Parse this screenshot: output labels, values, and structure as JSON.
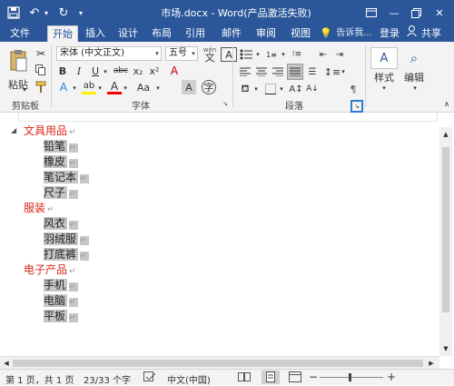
{
  "window": {
    "title": "市场.docx - Word(产品激活失败)",
    "restore_icon": "restore-icon",
    "min": "—",
    "close": "✕"
  },
  "tabs": [
    "文件",
    "开始",
    "插入",
    "设计",
    "布局",
    "引用",
    "邮件",
    "审阅",
    "视图"
  ],
  "tell_me": "告诉我...",
  "login": "登录",
  "share": "共享",
  "ribbon": {
    "paste": "粘贴",
    "font_name": "宋体 (中文正文)",
    "font_size": "五号",
    "wen": "wén",
    "styles": "样式",
    "editing": "编辑",
    "groups": {
      "clipboard": "剪贴板",
      "font": "字体",
      "paragraph": "段落"
    }
  },
  "document": {
    "lines": [
      {
        "text": "文具用品",
        "type": "heading"
      },
      {
        "text": "铅笔",
        "type": "item"
      },
      {
        "text": "橡皮",
        "type": "item"
      },
      {
        "text": "笔记本",
        "type": "item"
      },
      {
        "text": "尺子",
        "type": "item"
      },
      {
        "text": "服装",
        "type": "heading"
      },
      {
        "text": "风衣",
        "type": "item"
      },
      {
        "text": "羽绒服",
        "type": "item"
      },
      {
        "text": "打底裤",
        "type": "item"
      },
      {
        "text": "电子产品",
        "type": "heading"
      },
      {
        "text": "手机",
        "type": "item"
      },
      {
        "text": "电脑",
        "type": "item"
      },
      {
        "text": "平板",
        "type": "item"
      }
    ],
    "para_mark": "↵"
  },
  "status": {
    "page": "第 1 页，共 1 页",
    "words": "23/33 个字",
    "lang": "中文(中国)",
    "zoom_minus": "−",
    "zoom_plus": "+"
  },
  "colors": {
    "accent": "#2b579a",
    "heading": "#d9261c",
    "highlight": "#c6c6c6"
  }
}
